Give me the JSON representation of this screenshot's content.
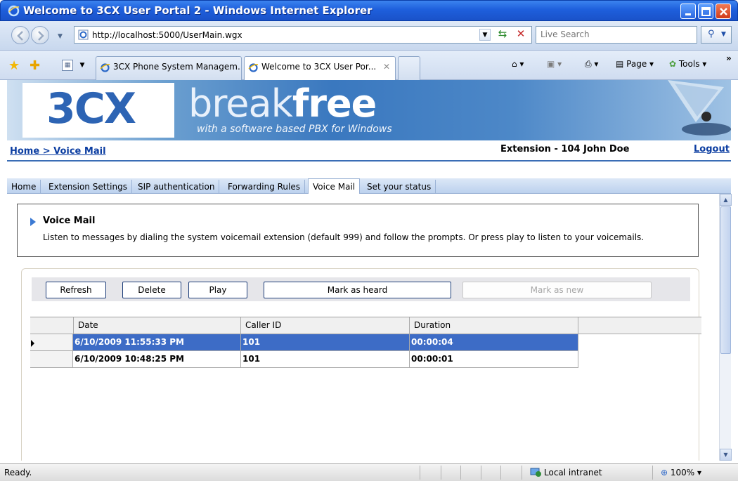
{
  "window": {
    "title": "Welcome to 3CX User Portal 2 - Windows Internet Explorer"
  },
  "addressbar": {
    "url": "http://localhost:5000/UserMain.wgx",
    "search_placeholder": "Live Search"
  },
  "browser_tabs": [
    {
      "label": "3CX Phone System Managem...",
      "active": false
    },
    {
      "label": "Welcome to 3CX User Por...",
      "active": true
    }
  ],
  "commandbar": {
    "page_label": "Page",
    "tools_label": "Tools"
  },
  "banner": {
    "logo": "3CX",
    "brand_word_light": "break",
    "brand_word_bold": "free",
    "tagline": "with a software based PBX for Windows"
  },
  "header": {
    "breadcrumb": "Home > Voice Mail",
    "user_info": "Extension - 104 John Doe",
    "logout": "Logout"
  },
  "page_tabs": [
    {
      "label": "Home",
      "active": false
    },
    {
      "label": "Extension Settings",
      "active": false
    },
    {
      "label": "SIP authentication",
      "active": false
    },
    {
      "label": "Forwarding Rules",
      "active": false
    },
    {
      "label": "Voice Mail",
      "active": true
    },
    {
      "label": "Set your status",
      "active": false
    }
  ],
  "voicemail": {
    "heading": "Voice Mail",
    "description": "Listen to messages by dialing the system voicemail extension (default 999) and follow the prompts. Or press play to listen to your voicemails.",
    "buttons": {
      "refresh": "Refresh",
      "delete": "Delete",
      "play": "Play",
      "mark_heard": "Mark as heard",
      "mark_new": "Mark as new"
    },
    "columns": [
      "Date",
      "Caller ID",
      "Duration"
    ],
    "rows": [
      {
        "date": "6/10/2009 11:55:33 PM",
        "caller_id": "101",
        "duration": "00:00:04",
        "selected": true
      },
      {
        "date": "6/10/2009 10:48:25 PM",
        "caller_id": "101",
        "duration": "00:00:01",
        "selected": false
      }
    ]
  },
  "statusbar": {
    "status": "Ready.",
    "zone": "Local intranet",
    "zoom": "100%"
  },
  "colors": {
    "titlebar": "#1e5fdc",
    "link": "#0b3da1",
    "selection": "#3d6cc6"
  },
  "icons": [
    "ie-logo-icon",
    "back-icon",
    "forward-icon",
    "refresh-icon",
    "stop-icon",
    "search-icon",
    "favorites-star-icon",
    "add-favorites-icon",
    "quick-tabs-icon",
    "home-icon",
    "feeds-icon",
    "print-icon",
    "page-icon",
    "tools-icon",
    "globe-icon",
    "zoom-icon"
  ]
}
